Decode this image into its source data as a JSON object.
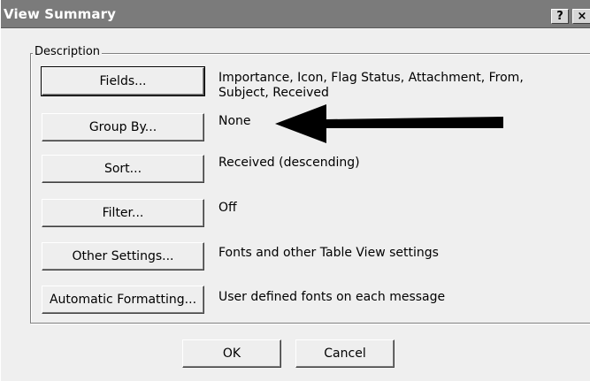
{
  "window": {
    "title": "View Summary",
    "help_label": "?",
    "close_label": "×"
  },
  "group": {
    "label": "Description"
  },
  "rows": [
    {
      "button": "Fields...",
      "value": "Importance, Icon, Flag Status, Attachment, From, Subject, Received"
    },
    {
      "button": "Group By...",
      "value": "None"
    },
    {
      "button": "Sort...",
      "value": "Received (descending)"
    },
    {
      "button": "Filter...",
      "value": "Off"
    },
    {
      "button": "Other Settings...",
      "value": "Fonts and other Table View settings"
    },
    {
      "button": "Automatic Formatting...",
      "value": "User defined fonts on each message"
    }
  ],
  "footer": {
    "ok_label": "OK",
    "cancel_label": "Cancel"
  },
  "annotation": {
    "icon": "left-arrow-icon",
    "color": "#000000"
  }
}
